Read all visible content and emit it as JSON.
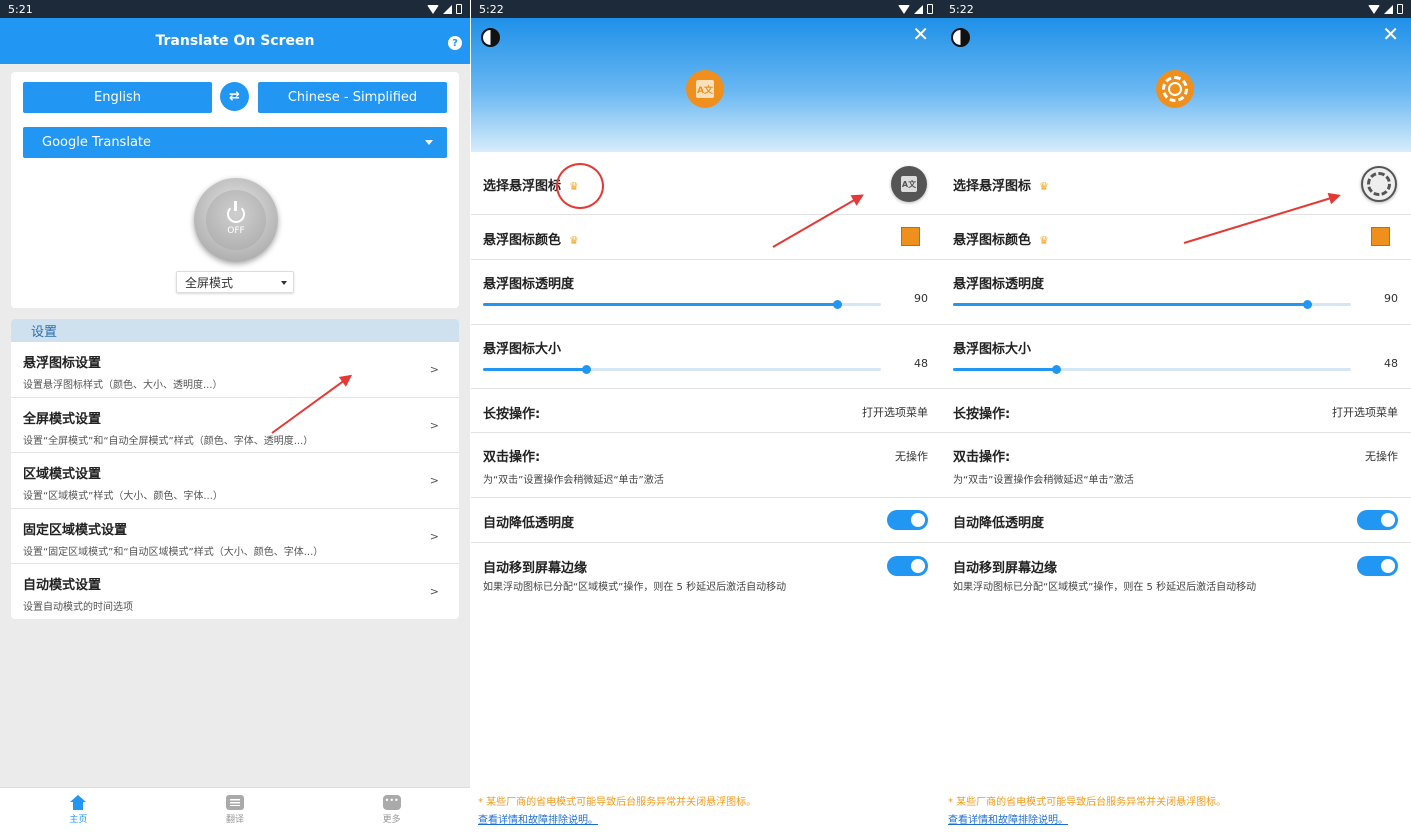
{
  "panel1": {
    "status_time": "5:21",
    "app_title": "Translate On Screen",
    "help_glyph": "?",
    "source_lang": "English",
    "target_lang": "Chinese - Simplified",
    "engine": "Google Translate",
    "power_state": "OFF",
    "mode": "全屏模式",
    "settings_header": "设置",
    "settings": [
      {
        "title": "悬浮图标设置",
        "subtitle": "设置悬浮图标样式（颜色、大小、透明度...）",
        "chevron": ">"
      },
      {
        "title": "全屏模式设置",
        "subtitle": "设置“全屏模式”和“自动全屏模式”样式（颜色、字体、透明度...）",
        "chevron": ">"
      },
      {
        "title": "区域模式设置",
        "subtitle": "设置“区域模式”样式（大小、颜色、字体...）",
        "chevron": ">"
      },
      {
        "title": "固定区域模式设置",
        "subtitle": "设置“固定区域模式”和“自动区域模式”样式（大小、颜色、字体...）",
        "chevron": ">"
      },
      {
        "title": "自动模式设置",
        "subtitle": "设置自动模式的时间选项",
        "chevron": ">"
      }
    ],
    "nav": [
      {
        "label": "主页",
        "icon": "home-icon",
        "active": true
      },
      {
        "label": "翻译",
        "icon": "list-icon",
        "active": false
      },
      {
        "label": "更多",
        "icon": "more-icon",
        "active": false
      }
    ]
  },
  "float_settings": {
    "status_time": "5:22",
    "close_glyph": "✕",
    "choose_icon": "选择悬浮图标",
    "icon_color": "悬浮图标颜色",
    "opacity_label": "悬浮图标透明度",
    "opacity_value": "90",
    "opacity_fraction": 0.89,
    "size_label": "悬浮图标大小",
    "size_value": "48",
    "size_fraction": 0.26,
    "long_press_label": "长按操作:",
    "long_press_value": "打开选项菜单",
    "double_tap_label": "双击操作:",
    "double_tap_value": "无操作",
    "double_tap_note": "为“双击”设置操作会稍微延迟“单击”激活",
    "auto_opacity_label": "自动降低透明度",
    "auto_edge_label": "自动移到屏幕边缘",
    "auto_edge_note": "如果浮动图标已分配“区域模式”操作，则在 5 秒延迟后激活自动移动",
    "footer_warning": "* 某些厂商的省电模式可能导致后台服务异常并关闭悬浮图标。",
    "footer_link": "查看详情和故障排除说明。",
    "crown_glyph": "♛",
    "badge_translate_glyph": "A文"
  },
  "colors": {
    "accent": "#2196f3",
    "premium": "#f5a623",
    "icon_color_swatch": "#f0901c",
    "annotation": "#e53935"
  }
}
